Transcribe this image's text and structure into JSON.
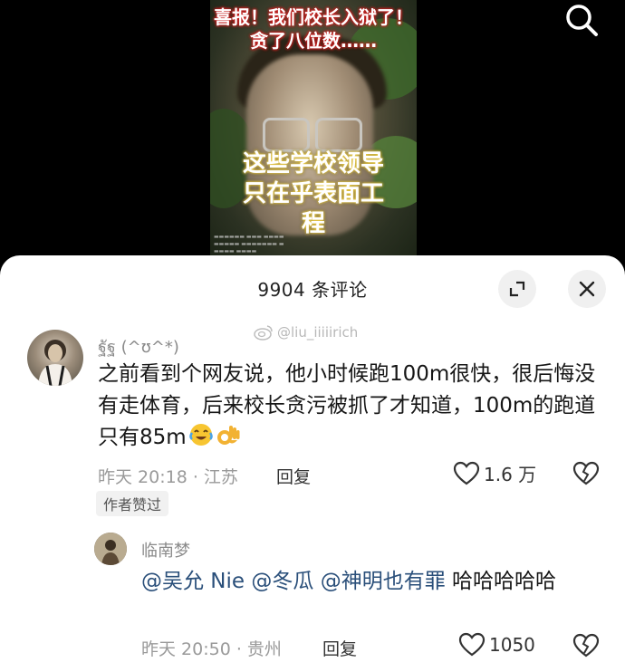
{
  "video": {
    "top_caption": [
      "喜报！我们校长入狱了！",
      "贪了八位数……"
    ],
    "middle_caption": [
      "这些学校领导",
      "只在乎表面工",
      "程"
    ]
  },
  "comments_panel": {
    "title": "9904 条评论",
    "watermark": "@liu_iiiiirich",
    "comments": [
      {
        "username": "ฐัฐ (^ʊ^*)",
        "text": "之前看到个网友说，他小时候跑100m很快，很后悔没有走体育，后来校长贪污被抓了才知道，100m的跑道只有85m",
        "time": "昨天 20:18 · 江苏",
        "reply_label": "回复",
        "likes": "1.6 万",
        "badge": "作者赞过"
      },
      {
        "username": "临南梦",
        "mentions": [
          "@吴允 Nie",
          "@冬瓜",
          "@神明也有罪"
        ],
        "text_after": "哈哈哈哈哈",
        "time": "昨天 20:50 · 贵州",
        "reply_label": "回复",
        "likes": "1050"
      }
    ]
  },
  "icons": [
    "search-icon",
    "expand-icon",
    "close-icon",
    "weibo-icon",
    "laugh-cry-emoji",
    "ok-hand-emoji",
    "heart-icon",
    "broken-heart-icon"
  ],
  "colors": {
    "sheet_bg": "#ffffff",
    "mention": "#2a4f7a",
    "meta": "#9a9a9a"
  }
}
